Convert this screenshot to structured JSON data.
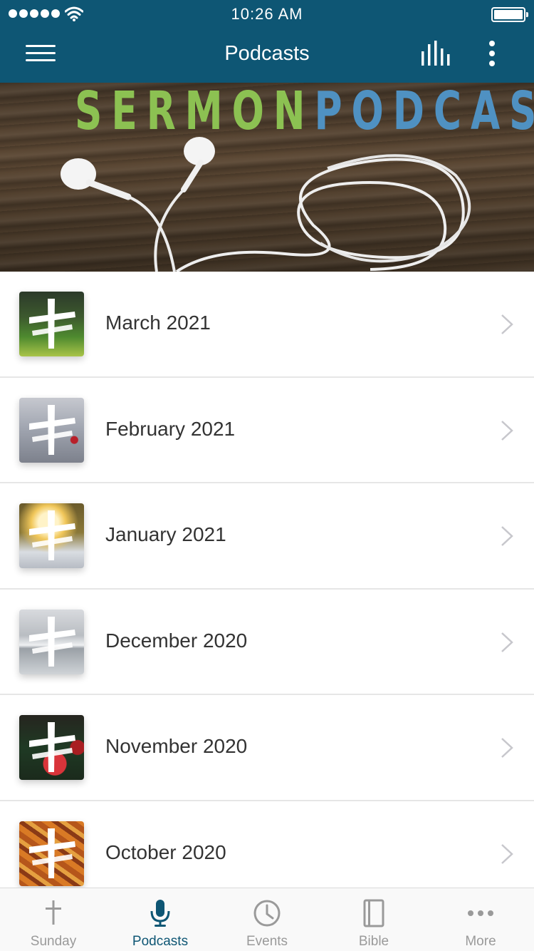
{
  "status_bar": {
    "time": "10:26 AM",
    "signal_icon": "signal-dots-icon",
    "wifi_icon": "wifi-icon",
    "battery_icon": "battery-icon"
  },
  "nav": {
    "title": "Podcasts",
    "menu_icon": "hamburger-menu-icon",
    "audio_icon": "audio-bars-icon",
    "more_icon": "vertical-ellipsis-icon"
  },
  "banner": {
    "title_part1": "SERMON",
    "title_part2": "PODCAST"
  },
  "items": [
    {
      "label": "March 2021"
    },
    {
      "label": "February 2021"
    },
    {
      "label": "January 2021"
    },
    {
      "label": "December 2020"
    },
    {
      "label": "November 2020"
    },
    {
      "label": "October 2020"
    }
  ],
  "tabs": [
    {
      "label": "Sunday",
      "icon": "cross-icon"
    },
    {
      "label": "Podcasts",
      "icon": "microphone-icon"
    },
    {
      "label": "Events",
      "icon": "clock-icon"
    },
    {
      "label": "Bible",
      "icon": "book-icon"
    },
    {
      "label": "More",
      "icon": "ellipsis-icon"
    }
  ],
  "active_tab": "Podcasts",
  "colors": {
    "brand": "#0e5674",
    "banner_green": "#8cc152",
    "banner_blue": "#4f91c2",
    "tab_inactive": "#9a9a9a"
  }
}
